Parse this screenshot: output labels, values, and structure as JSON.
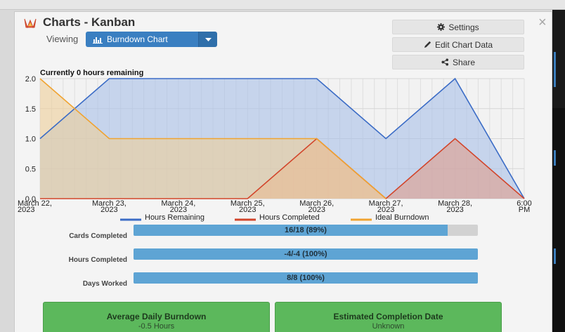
{
  "window": {
    "title": "Charts - Kanban",
    "close_glyph": "×"
  },
  "viewing": {
    "label": "Viewing",
    "selected": "Burndown Chart"
  },
  "actions": [
    {
      "label": "Settings",
      "icon": "gear-icon"
    },
    {
      "label": "Edit Chart Data",
      "icon": "pencil-icon"
    },
    {
      "label": "Share",
      "icon": "share-icon"
    }
  ],
  "chart_data": {
    "type": "area",
    "title": "Currently 0 hours remaining",
    "categories": [
      "March 22,\n2023",
      "March 23,\n2023",
      "March 24,\n2023",
      "March 25,\n2023",
      "March 26,\n2023",
      "March 27,\n2023",
      "March 28,\n2023",
      "6:00\nPM"
    ],
    "y_ticks": [
      "0.0",
      "0.5",
      "1.0",
      "1.5",
      "2.0"
    ],
    "ylim": [
      0,
      2
    ],
    "grid": true,
    "legend_position": "bottom",
    "series": [
      {
        "name": "Hours Remaining",
        "color": "#3b6cc6",
        "fill": "#a9bfe8",
        "points": [
          [
            0,
            1
          ],
          [
            1,
            2
          ],
          [
            4,
            2
          ],
          [
            5,
            1
          ],
          [
            6,
            2
          ],
          [
            7,
            0
          ]
        ]
      },
      {
        "name": "Hours Completed",
        "color": "#d2452b",
        "fill": "#e09d8c",
        "points": [
          [
            0,
            0
          ],
          [
            3,
            0
          ],
          [
            4,
            1
          ],
          [
            5,
            0
          ],
          [
            6,
            1
          ],
          [
            7,
            0
          ]
        ]
      },
      {
        "name": "Ideal Burndown",
        "color": "#f0a330",
        "fill": "#efcf9a",
        "points": [
          [
            0,
            2
          ],
          [
            1,
            1
          ],
          [
            4,
            1
          ],
          [
            5,
            0
          ]
        ]
      }
    ]
  },
  "stats": [
    {
      "label": "Cards Completed",
      "value": "16/18 (89%)",
      "fraction": 0.912
    },
    {
      "label": "Hours Completed",
      "value": "-4/-4 (100%)",
      "fraction": 1.0
    },
    {
      "label": "Days Worked",
      "value": "8/8 (100%)",
      "fraction": 1.0
    }
  ],
  "summary_cards": [
    {
      "heading": "Average Daily Burndown",
      "value": "-0.5 Hours"
    },
    {
      "heading": "Estimated Completion Date",
      "value": "Unknown"
    }
  ]
}
